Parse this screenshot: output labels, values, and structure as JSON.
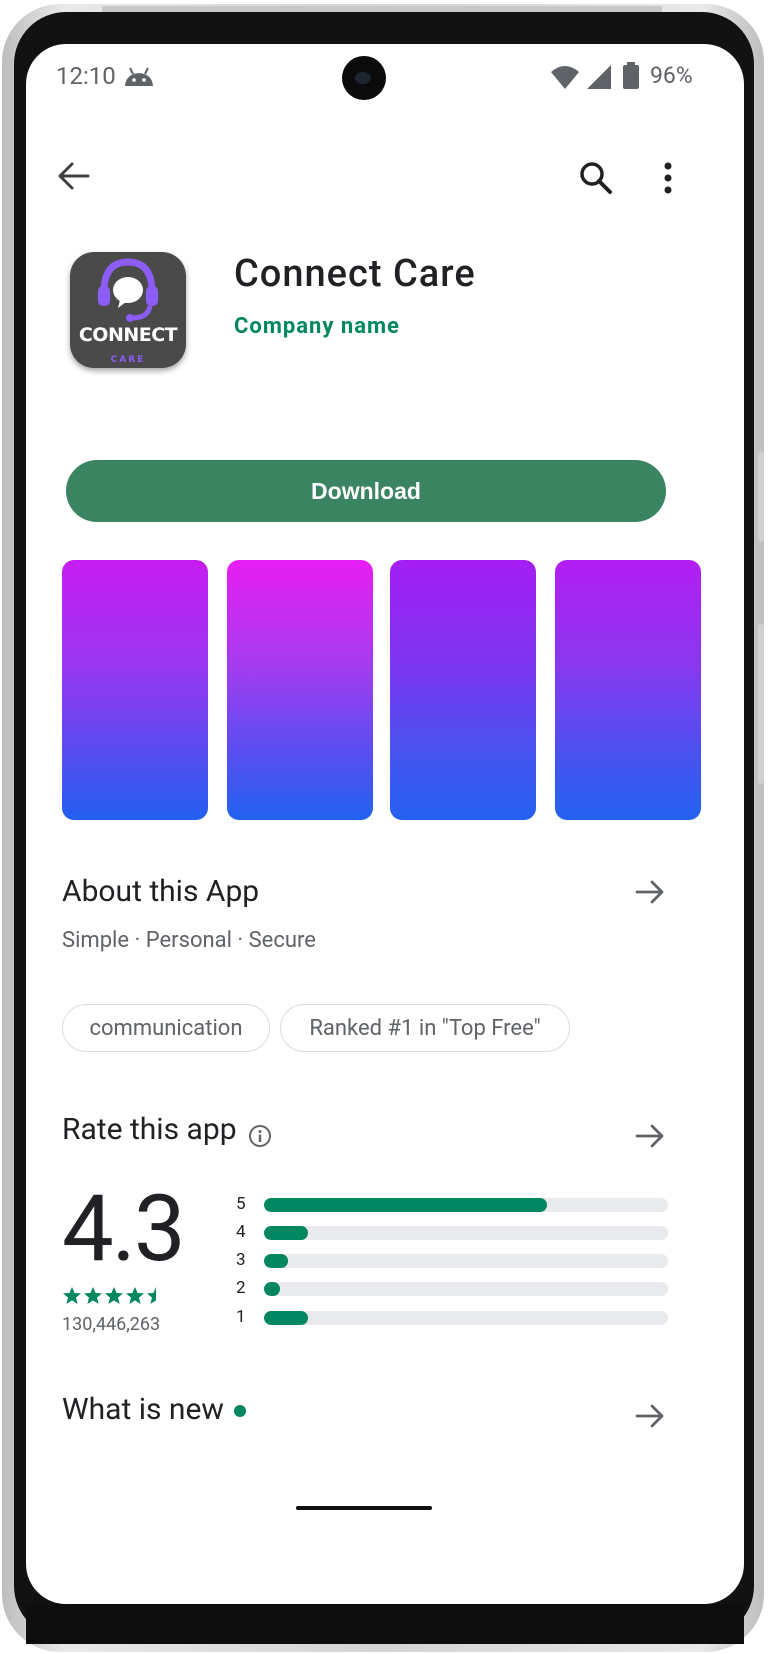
{
  "status": {
    "time": "12:10",
    "battery": "96%"
  },
  "app": {
    "title": "Connect Care",
    "company": "Company name",
    "icon_text": "CONNECT",
    "icon_subtext": "CARE",
    "icon_bg": "#4a4a4a",
    "icon_accent": "#8b5cf6"
  },
  "actions": {
    "download_label": "Download",
    "download_color": "#3b8462"
  },
  "screenshots": [
    {
      "name": "screenshot-1"
    },
    {
      "name": "screenshot-2"
    },
    {
      "name": "screenshot-3"
    },
    {
      "name": "screenshot-4"
    }
  ],
  "about": {
    "title": "About this App",
    "subtitle": "Simple · Personal · Secure"
  },
  "chips": [
    "communication",
    "Ranked #1 in \"Top Free\""
  ],
  "rating": {
    "title": "Rate this app",
    "score": "4.3",
    "stars": 4.5,
    "count": "130,446,263",
    "distribution": [
      {
        "label": "5",
        "fraction": 0.7
      },
      {
        "label": "4",
        "fraction": 0.11
      },
      {
        "label": "3",
        "fraction": 0.06
      },
      {
        "label": "2",
        "fraction": 0.04
      },
      {
        "label": "1",
        "fraction": 0.11
      }
    ],
    "accent": "#01875f"
  },
  "whats_new": {
    "title": "What is new"
  },
  "icons": {
    "back": "arrow-back-icon",
    "search": "search-icon",
    "more": "more-vert-icon",
    "section_arrow": "arrow-forward-icon",
    "info": "info-icon"
  }
}
